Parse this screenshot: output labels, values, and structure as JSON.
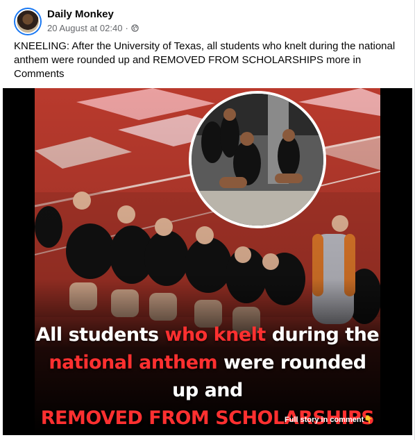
{
  "post": {
    "author": "Daily Monkey",
    "timestamp": "20 August at 02:40",
    "separator": "·",
    "privacy_icon": "globe-icon",
    "text": "KNEELING: After the University of Texas, all students who knelt during the national anthem were rounded up and REMOVED FROM SCHOLARSHIPS more in Comments"
  },
  "image": {
    "caption": {
      "line1_a": "All students ",
      "line1_b": "who knelt",
      "line1_c": " during the",
      "line2_a": "national anthem",
      "line2_b": " were rounded up and",
      "line3": "REMOVED FROM SCHOLARSHIPS"
    },
    "footer": "Full story in comment👇",
    "colors": {
      "highlight": "#ff3030",
      "court": "#b2352c"
    }
  }
}
